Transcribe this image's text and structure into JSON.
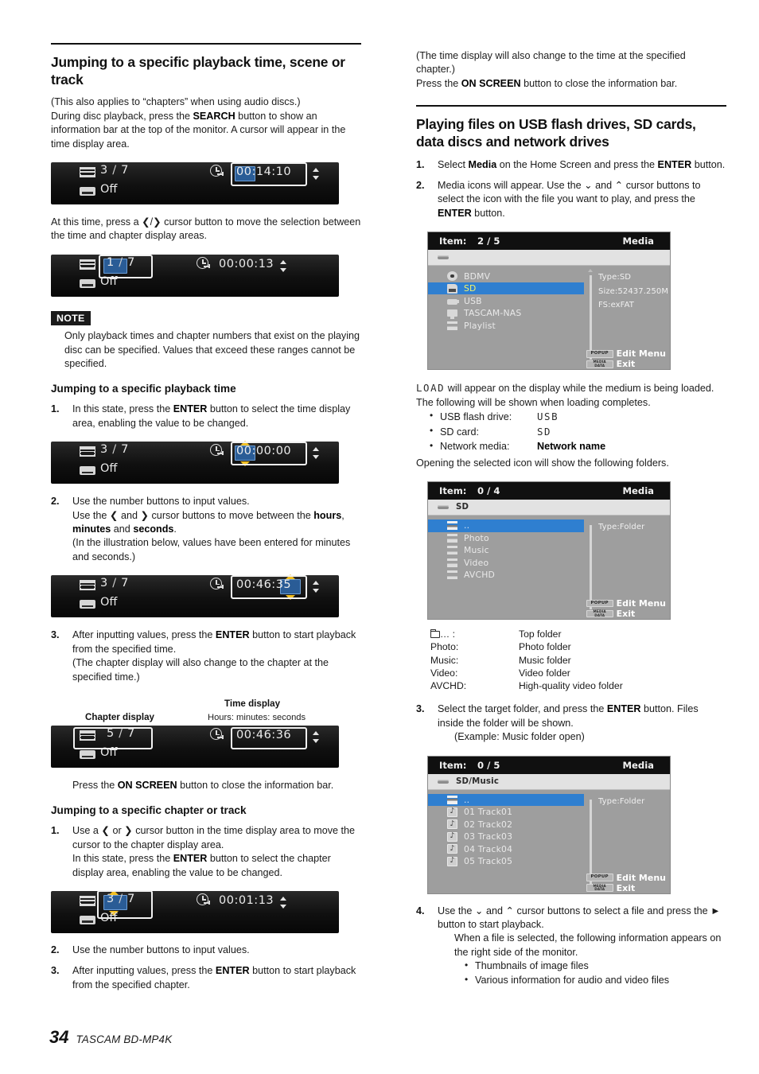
{
  "document": {
    "footer": {
      "page_number": "34",
      "model": "TASCAM BD-MP4K"
    }
  },
  "left_column": {
    "section_title": "Jumping to a specific playback time, scene or track",
    "intro_line1": "(This also applies to “chapters” when using audio discs.)",
    "intro_line2_a": "During disc playback, press the ",
    "intro_line2_b": "SEARCH",
    "intro_line2_c": " button to show an information bar at the top of the monitor. A cursor will appear in the time display area.",
    "after_osd1": "At this time, press a ❮/❯ cursor button to move the selection between the time and chapter display areas.",
    "note_label": "NOTE",
    "note_text": "Only playback times and chapter numbers that exist on the playing disc can be specified. Values that exceed these ranges cannot be specified.",
    "sub1_title": "Jumping to a specific playback time",
    "sub1_step1_num": "1.",
    "sub1_step1_a": "In this state, press the ",
    "sub1_step1_b": "ENTER",
    "sub1_step1_c": " button to select the time display area, enabling the value to be changed.",
    "sub1_step2_num": "2.",
    "sub1_step2_line1": "Use the number buttons to input values.",
    "sub1_step2_line2_a": "Use the ❮ and ❯ cursor buttons to move between the ",
    "sub1_step2_line2_b": "hours",
    "sub1_step2_line2_c": ", ",
    "sub1_step2_line2_d": "minutes",
    "sub1_step2_line2_e": " and ",
    "sub1_step2_line2_f": "seconds",
    "sub1_step2_line2_g": ".",
    "sub1_step2_line3": "(In the illustration below, values have been entered for minutes and seconds.)",
    "sub1_step3_num": "3.",
    "sub1_step3_a": "After inputting values, press the ",
    "sub1_step3_b": "ENTER",
    "sub1_step3_c": " button to start playback from the specified time.",
    "sub1_step3_line2": "(The chapter display will also change to the chapter at the specified time.)",
    "caption_chapter": "Chapter display",
    "caption_time": "Time display",
    "caption_time_sub": "Hours: minutes: seconds",
    "onscreen_a": "Press the ",
    "onscreen_b": "ON SCREEN",
    "onscreen_c": " button to close the information bar.",
    "sub2_title": "Jumping to a specific chapter or track",
    "sub2_step1_num": "1.",
    "sub2_step1_line1": "Use a ❮ or ❯ cursor button in the time display area to move the cursor to the chapter display area.",
    "sub2_step1_line2_a": "In this state, press the ",
    "sub2_step1_line2_b": "ENTER",
    "sub2_step1_line2_c": " button to select the chapter display area, enabling the value to be changed.",
    "sub2_step2_num": "2.",
    "sub2_step2_text": "Use the number buttons to input values.",
    "sub2_step3_num": "3.",
    "sub2_step3_a": "After inputting values, press the ",
    "sub2_step3_b": "ENTER",
    "sub2_step3_c": " button to start playback from the specified chapter."
  },
  "osd_bars": {
    "bar1": {
      "chapter_current": "3",
      "chapter_sep": "/",
      "chapter_total": "7",
      "subtitle": "Off",
      "time_h": "00",
      "time_m": ":14:",
      "time_s": "10"
    },
    "bar2": {
      "chapter_current": "1",
      "chapter_sep": "/",
      "chapter_total": "7",
      "subtitle": "Off",
      "time_h": "00",
      "time_m": ":00:",
      "time_s": "13"
    },
    "bar3": {
      "chapter_current": "3",
      "chapter_sep": "/",
      "chapter_total": "7",
      "subtitle": "Off",
      "time_h": "00",
      "time_m": ":00:",
      "time_s": "00"
    },
    "bar4": {
      "chapter_current": "3",
      "chapter_sep": "/",
      "chapter_total": "7",
      "subtitle": "Off",
      "time_h": "00",
      "time_m": ":46:",
      "time_s": "35"
    },
    "bar5": {
      "chapter_current": "5",
      "chapter_sep": "/",
      "chapter_total": "7",
      "subtitle": "Off",
      "time_h": "00",
      "time_m": ":46:",
      "time_s": "36"
    },
    "bar6": {
      "chapter_current": "3",
      "chapter_sep": "/",
      "chapter_total": "7",
      "subtitle": "Off",
      "time_h": "00",
      "time_m": ":01:",
      "time_s": "13"
    }
  },
  "right_column": {
    "top_line1": "(The time display will also change to the time at the specified chapter.)",
    "top_line2_a": "Press the ",
    "top_line2_b": "ON SCREEN",
    "top_line2_c": " button to close the information bar.",
    "section_title": "Playing files on USB flash drives, SD cards, data discs and network drives",
    "step1_num": "1.",
    "step1_a": "Select ",
    "step1_b": "Media",
    "step1_c": " on the Home Screen and press the ",
    "step1_d": "ENTER",
    "step1_e": " button.",
    "step2_num": "2.",
    "step2_a": "Media icons will appear. Use the ⌄ and ⌃ cursor buttons to select the icon with the file you want to play, and press the ",
    "step2_b": "ENTER",
    "step2_c": " button.",
    "load_lcd": "LOAD",
    "load_text": " will appear on the display while the medium is being loaded. The following will be shown when loading completes.",
    "bullets": [
      {
        "label": "USB flash drive:",
        "value": "USB",
        "style": "lcd"
      },
      {
        "label": "SD card:",
        "value": "SD",
        "style": "lcd"
      },
      {
        "label": "Network media:",
        "value": "Network name",
        "style": "bold"
      }
    ],
    "opening_text": "Opening the selected icon will show the following folders.",
    "legend": [
      {
        "key": "… :",
        "value": "Top folder",
        "icon": "folder-icon"
      },
      {
        "key": "Photo:",
        "value": "Photo folder"
      },
      {
        "key": "Music:",
        "value": "Music folder"
      },
      {
        "key": "Video:",
        "value": "Video folder"
      },
      {
        "key": "AVCHD:",
        "value": "High-quality video folder"
      }
    ],
    "step3_num": "3.",
    "step3_a": "Select the target folder, and press the ",
    "step3_b": "ENTER",
    "step3_c": " button. Files inside the folder will be shown.",
    "step3_example": "(Example: Music folder open)",
    "step4_num": "4.",
    "step4_a": "Use the ⌄ and ⌃ cursor buttons to select a file and press the ► button to start playback.",
    "step4_line2": "When a file is selected, the following information appears on the right side of the monitor.",
    "step4_bullets": [
      "Thumbnails of image files",
      "Various information for audio and video files"
    ]
  },
  "media_screens": {
    "screen1": {
      "item_label": "Item:",
      "item_count": "2 / 5",
      "title": "Media",
      "path": "",
      "rows": [
        {
          "label": "BDMV",
          "icon": "disc-icon",
          "selected": false
        },
        {
          "label": "SD",
          "icon": "sd-card-icon",
          "selected": true
        },
        {
          "label": "USB",
          "icon": "usb-icon",
          "selected": false
        },
        {
          "label": "TASCAM-NAS",
          "icon": "network-icon",
          "selected": false
        },
        {
          "label": "Playlist",
          "icon": "playlist-icon",
          "selected": false
        }
      ],
      "info": [
        "Type:SD",
        "Size:52437.250M",
        "FS:exFAT"
      ],
      "hints": [
        {
          "key": "POPUP",
          "key2": "",
          "text": "Edit Menu"
        },
        {
          "key": "MEDIA",
          "key2": "DATA",
          "text": "Exit"
        }
      ]
    },
    "screen2": {
      "item_label": "Item:",
      "item_count": "0 / 4",
      "title": "Media",
      "path": "SD",
      "rows": [
        {
          "label": "..",
          "icon": "up-folder-icon",
          "selected": true
        },
        {
          "label": "Photo",
          "icon": "folder-icon",
          "selected": false
        },
        {
          "label": "Music",
          "icon": "folder-icon",
          "selected": false
        },
        {
          "label": "Video",
          "icon": "folder-icon",
          "selected": false
        },
        {
          "label": "AVCHD",
          "icon": "folder-icon",
          "selected": false
        }
      ],
      "info": [
        "Type:Folder"
      ],
      "hints": [
        {
          "key": "POPUP",
          "key2": "",
          "text": "Edit Menu"
        },
        {
          "key": "MEDIA",
          "key2": "DATA",
          "text": "Exit"
        }
      ]
    },
    "screen3": {
      "item_label": "Item:",
      "item_count": "0 / 5",
      "title": "Media",
      "path": "SD/Music",
      "rows": [
        {
          "label": "..",
          "icon": "up-folder-icon",
          "selected": true
        },
        {
          "label": "01 Track01",
          "icon": "music-file-icon",
          "selected": false
        },
        {
          "label": "02 Track02",
          "icon": "music-file-icon",
          "selected": false
        },
        {
          "label": "03 Track03",
          "icon": "music-file-icon",
          "selected": false
        },
        {
          "label": "04 Track04",
          "icon": "music-file-icon",
          "selected": false
        },
        {
          "label": "05 Track05",
          "icon": "music-file-icon",
          "selected": false
        }
      ],
      "info": [
        "Type:Folder"
      ],
      "hints": [
        {
          "key": "POPUP",
          "key2": "",
          "text": "Edit Menu"
        },
        {
          "key": "MEDIA",
          "key2": "DATA",
          "text": "Exit"
        }
      ]
    }
  }
}
